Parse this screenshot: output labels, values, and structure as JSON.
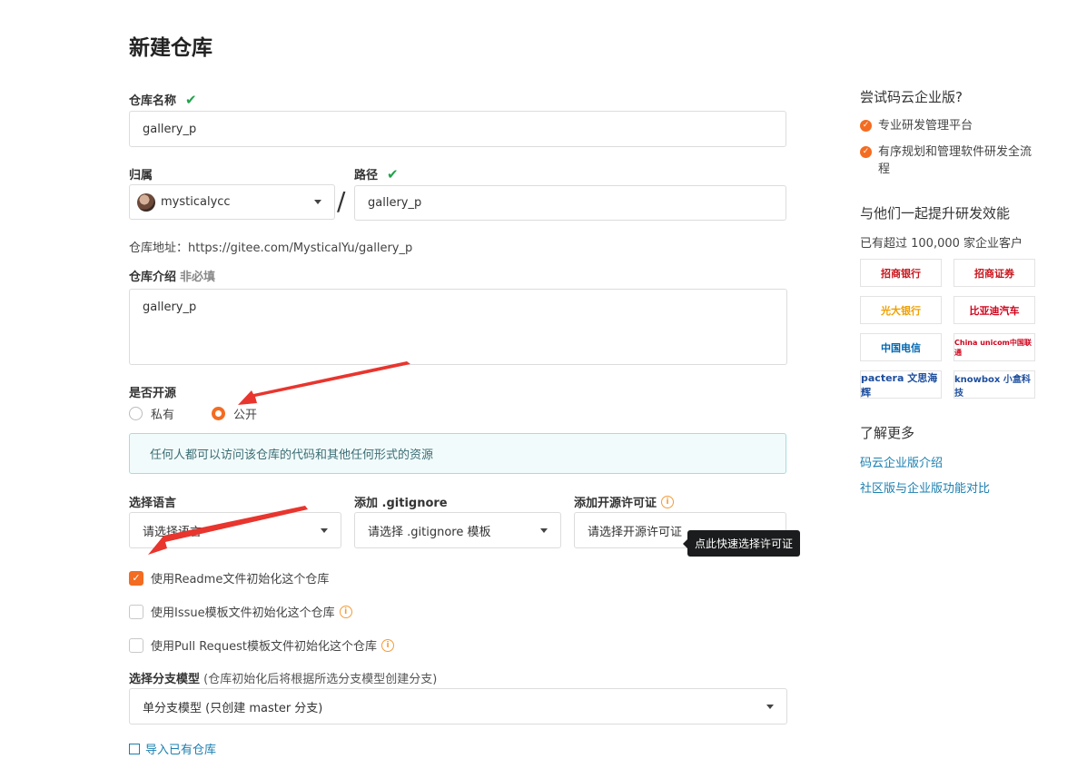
{
  "page": {
    "title": "新建仓库"
  },
  "form": {
    "repo_name": {
      "label": "仓库名称",
      "value": "gallery_p"
    },
    "owner": {
      "label": "归属",
      "value": "mysticalycc"
    },
    "path": {
      "label": "路径",
      "value": "gallery_p"
    },
    "address": "仓库地址：https://gitee.com/MysticalYu/gallery_p",
    "description": {
      "label": "仓库介绍",
      "optional": "非必填",
      "value": "gallery_p"
    },
    "visibility": {
      "label": "是否开源",
      "options": [
        "私有",
        "公开"
      ],
      "selected": "公开"
    },
    "visibility_info": "任何人都可以访问该仓库的代码和其他任何形式的资源",
    "language": {
      "label": "选择语言",
      "value": "请选择语言"
    },
    "gitignore": {
      "label": "添加 .gitignore",
      "value": "请选择 .gitignore 模板"
    },
    "license": {
      "label": "添加开源许可证",
      "value": "请选择开源许可证",
      "tooltip": "点此快速选择许可证"
    },
    "checkboxes": [
      {
        "label": "使用Readme文件初始化这个仓库",
        "checked": true
      },
      {
        "label": "使用Issue模板文件初始化这个仓库",
        "checked": false
      },
      {
        "label": "使用Pull Request模板文件初始化这个仓库",
        "checked": false
      }
    ],
    "branch_model": {
      "label": "选择分支模型",
      "hint": "(仓库初始化后将根据所选分支模型创建分支)",
      "value": "单分支模型 (只创建 master 分支)"
    },
    "import_link": "导入已有仓库"
  },
  "sidebar": {
    "promo_title": "尝试码云企业版?",
    "promo_items": [
      "专业研发管理平台",
      "有序规划和管理软件研发全流程"
    ],
    "partners_title": "与他们一起提升研发效能",
    "partners_sub": "已有超过 100,000 家企业客户",
    "logos": [
      "招商银行",
      "招商证券",
      "光大银行",
      "比亚迪汽车",
      "中国电信",
      "China unicom中国联通",
      "pactera 文思海辉",
      "knowbox 小盒科技"
    ],
    "more_title": "了解更多",
    "links": [
      "码云企业版介绍",
      "社区版与企业版功能对比"
    ]
  },
  "colors": {
    "accent": "#f36c21",
    "check": "#21a34b",
    "link": "#1a7fb0",
    "arrow": "#e8352e"
  }
}
